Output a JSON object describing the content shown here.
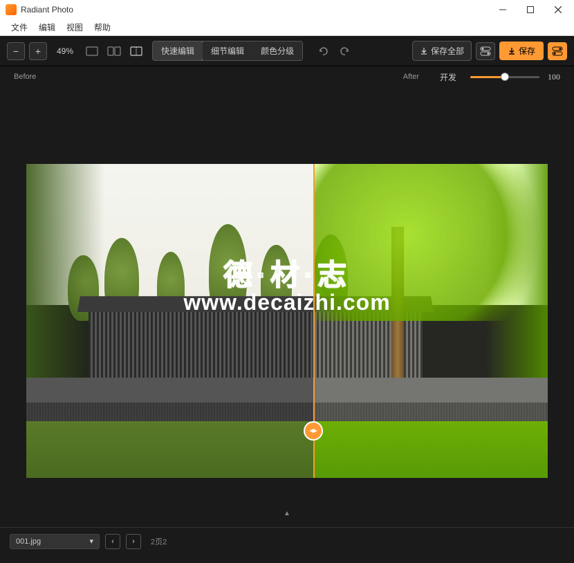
{
  "app": {
    "title": "Radiant Photo"
  },
  "menu": {
    "file": "文件",
    "edit": "编辑",
    "view": "视图",
    "help": "帮助"
  },
  "toolbar": {
    "zoom": "49%",
    "tabs": {
      "quick": "快速编辑",
      "detail": "细节编辑",
      "color": "颜色分级"
    },
    "save_all": "保存全部",
    "save": "保存"
  },
  "compare": {
    "before": "Before",
    "after": "After",
    "dev": "开发",
    "value": "100"
  },
  "watermark": {
    "line1": "德·材·志",
    "line2": "www.decaizhi.com"
  },
  "footer": {
    "filename": "001.jpg",
    "pages": "2页2"
  }
}
